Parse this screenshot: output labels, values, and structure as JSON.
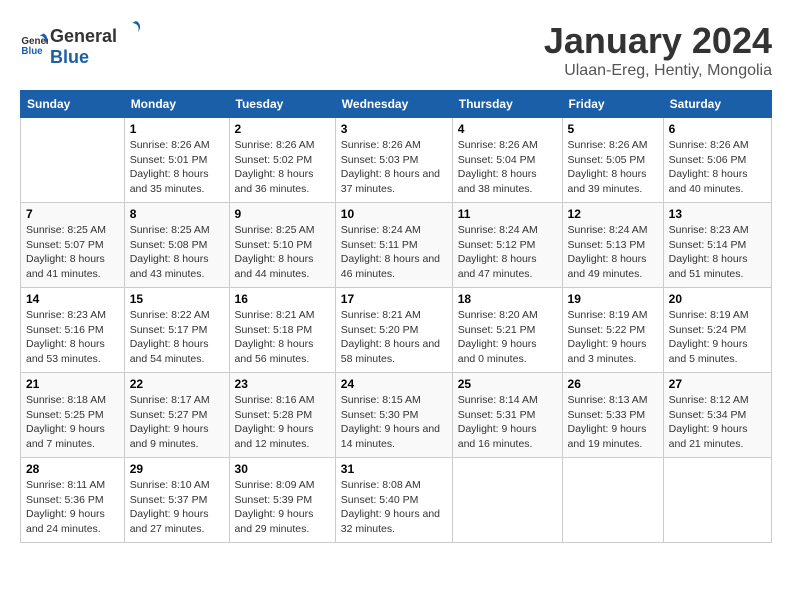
{
  "header": {
    "logo_general": "General",
    "logo_blue": "Blue",
    "month_year": "January 2024",
    "location": "Ulaan-Ereg, Hentiy, Mongolia"
  },
  "days_of_week": [
    "Sunday",
    "Monday",
    "Tuesday",
    "Wednesday",
    "Thursday",
    "Friday",
    "Saturday"
  ],
  "weeks": [
    [
      {
        "date": "",
        "sunrise": "",
        "sunset": "",
        "daylight": ""
      },
      {
        "date": "1",
        "sunrise": "Sunrise: 8:26 AM",
        "sunset": "Sunset: 5:01 PM",
        "daylight": "Daylight: 8 hours and 35 minutes."
      },
      {
        "date": "2",
        "sunrise": "Sunrise: 8:26 AM",
        "sunset": "Sunset: 5:02 PM",
        "daylight": "Daylight: 8 hours and 36 minutes."
      },
      {
        "date": "3",
        "sunrise": "Sunrise: 8:26 AM",
        "sunset": "Sunset: 5:03 PM",
        "daylight": "Daylight: 8 hours and 37 minutes."
      },
      {
        "date": "4",
        "sunrise": "Sunrise: 8:26 AM",
        "sunset": "Sunset: 5:04 PM",
        "daylight": "Daylight: 8 hours and 38 minutes."
      },
      {
        "date": "5",
        "sunrise": "Sunrise: 8:26 AM",
        "sunset": "Sunset: 5:05 PM",
        "daylight": "Daylight: 8 hours and 39 minutes."
      },
      {
        "date": "6",
        "sunrise": "Sunrise: 8:26 AM",
        "sunset": "Sunset: 5:06 PM",
        "daylight": "Daylight: 8 hours and 40 minutes."
      }
    ],
    [
      {
        "date": "7",
        "sunrise": "Sunrise: 8:25 AM",
        "sunset": "Sunset: 5:07 PM",
        "daylight": "Daylight: 8 hours and 41 minutes."
      },
      {
        "date": "8",
        "sunrise": "Sunrise: 8:25 AM",
        "sunset": "Sunset: 5:08 PM",
        "daylight": "Daylight: 8 hours and 43 minutes."
      },
      {
        "date": "9",
        "sunrise": "Sunrise: 8:25 AM",
        "sunset": "Sunset: 5:10 PM",
        "daylight": "Daylight: 8 hours and 44 minutes."
      },
      {
        "date": "10",
        "sunrise": "Sunrise: 8:24 AM",
        "sunset": "Sunset: 5:11 PM",
        "daylight": "Daylight: 8 hours and 46 minutes."
      },
      {
        "date": "11",
        "sunrise": "Sunrise: 8:24 AM",
        "sunset": "Sunset: 5:12 PM",
        "daylight": "Daylight: 8 hours and 47 minutes."
      },
      {
        "date": "12",
        "sunrise": "Sunrise: 8:24 AM",
        "sunset": "Sunset: 5:13 PM",
        "daylight": "Daylight: 8 hours and 49 minutes."
      },
      {
        "date": "13",
        "sunrise": "Sunrise: 8:23 AM",
        "sunset": "Sunset: 5:14 PM",
        "daylight": "Daylight: 8 hours and 51 minutes."
      }
    ],
    [
      {
        "date": "14",
        "sunrise": "Sunrise: 8:23 AM",
        "sunset": "Sunset: 5:16 PM",
        "daylight": "Daylight: 8 hours and 53 minutes."
      },
      {
        "date": "15",
        "sunrise": "Sunrise: 8:22 AM",
        "sunset": "Sunset: 5:17 PM",
        "daylight": "Daylight: 8 hours and 54 minutes."
      },
      {
        "date": "16",
        "sunrise": "Sunrise: 8:21 AM",
        "sunset": "Sunset: 5:18 PM",
        "daylight": "Daylight: 8 hours and 56 minutes."
      },
      {
        "date": "17",
        "sunrise": "Sunrise: 8:21 AM",
        "sunset": "Sunset: 5:20 PM",
        "daylight": "Daylight: 8 hours and 58 minutes."
      },
      {
        "date": "18",
        "sunrise": "Sunrise: 8:20 AM",
        "sunset": "Sunset: 5:21 PM",
        "daylight": "Daylight: 9 hours and 0 minutes."
      },
      {
        "date": "19",
        "sunrise": "Sunrise: 8:19 AM",
        "sunset": "Sunset: 5:22 PM",
        "daylight": "Daylight: 9 hours and 3 minutes."
      },
      {
        "date": "20",
        "sunrise": "Sunrise: 8:19 AM",
        "sunset": "Sunset: 5:24 PM",
        "daylight": "Daylight: 9 hours and 5 minutes."
      }
    ],
    [
      {
        "date": "21",
        "sunrise": "Sunrise: 8:18 AM",
        "sunset": "Sunset: 5:25 PM",
        "daylight": "Daylight: 9 hours and 7 minutes."
      },
      {
        "date": "22",
        "sunrise": "Sunrise: 8:17 AM",
        "sunset": "Sunset: 5:27 PM",
        "daylight": "Daylight: 9 hours and 9 minutes."
      },
      {
        "date": "23",
        "sunrise": "Sunrise: 8:16 AM",
        "sunset": "Sunset: 5:28 PM",
        "daylight": "Daylight: 9 hours and 12 minutes."
      },
      {
        "date": "24",
        "sunrise": "Sunrise: 8:15 AM",
        "sunset": "Sunset: 5:30 PM",
        "daylight": "Daylight: 9 hours and 14 minutes."
      },
      {
        "date": "25",
        "sunrise": "Sunrise: 8:14 AM",
        "sunset": "Sunset: 5:31 PM",
        "daylight": "Daylight: 9 hours and 16 minutes."
      },
      {
        "date": "26",
        "sunrise": "Sunrise: 8:13 AM",
        "sunset": "Sunset: 5:33 PM",
        "daylight": "Daylight: 9 hours and 19 minutes."
      },
      {
        "date": "27",
        "sunrise": "Sunrise: 8:12 AM",
        "sunset": "Sunset: 5:34 PM",
        "daylight": "Daylight: 9 hours and 21 minutes."
      }
    ],
    [
      {
        "date": "28",
        "sunrise": "Sunrise: 8:11 AM",
        "sunset": "Sunset: 5:36 PM",
        "daylight": "Daylight: 9 hours and 24 minutes."
      },
      {
        "date": "29",
        "sunrise": "Sunrise: 8:10 AM",
        "sunset": "Sunset: 5:37 PM",
        "daylight": "Daylight: 9 hours and 27 minutes."
      },
      {
        "date": "30",
        "sunrise": "Sunrise: 8:09 AM",
        "sunset": "Sunset: 5:39 PM",
        "daylight": "Daylight: 9 hours and 29 minutes."
      },
      {
        "date": "31",
        "sunrise": "Sunrise: 8:08 AM",
        "sunset": "Sunset: 5:40 PM",
        "daylight": "Daylight: 9 hours and 32 minutes."
      },
      {
        "date": "",
        "sunrise": "",
        "sunset": "",
        "daylight": ""
      },
      {
        "date": "",
        "sunrise": "",
        "sunset": "",
        "daylight": ""
      },
      {
        "date": "",
        "sunrise": "",
        "sunset": "",
        "daylight": ""
      }
    ]
  ]
}
